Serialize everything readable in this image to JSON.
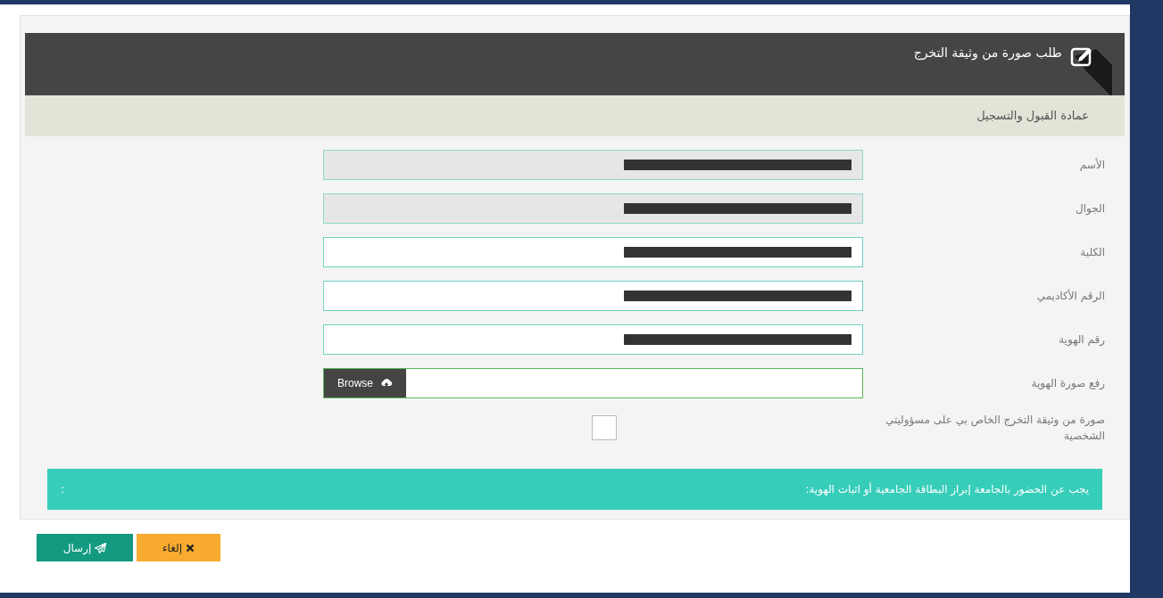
{
  "panel": {
    "title": "طلب صورة من وثيقة التخرج",
    "subtitle": "عمادة القبول والتسجيل"
  },
  "fields": [
    {
      "kind": "text",
      "label": "الأسم",
      "disabled": true,
      "redacted": true
    },
    {
      "kind": "text",
      "label": "الجوال",
      "disabled": true,
      "redacted": true
    },
    {
      "kind": "text",
      "label": "الكلية",
      "disabled": false,
      "redacted": true
    },
    {
      "kind": "text",
      "label": "الرقم الأكاديمي",
      "disabled": false,
      "redacted": true
    },
    {
      "kind": "text",
      "label": "رقم الهوية",
      "disabled": false,
      "redacted": true
    },
    {
      "kind": "file",
      "label": "رفع صورة الهوية",
      "button": "Browse"
    },
    {
      "kind": "checkbox",
      "label": "صورة من وثيقة التخرج الخاص بي على مسؤوليتي الشخصية",
      "checked": false
    }
  ],
  "notice": {
    "text": "يجب عن الحضور بالجامعة إبراز البطاقة الجامعية أو اثبات الهوية:",
    "trailing": ":"
  },
  "buttons": [
    {
      "kind": "cancel",
      "label": "إلغاء"
    },
    {
      "kind": "submit",
      "label": "إرسال"
    }
  ]
}
